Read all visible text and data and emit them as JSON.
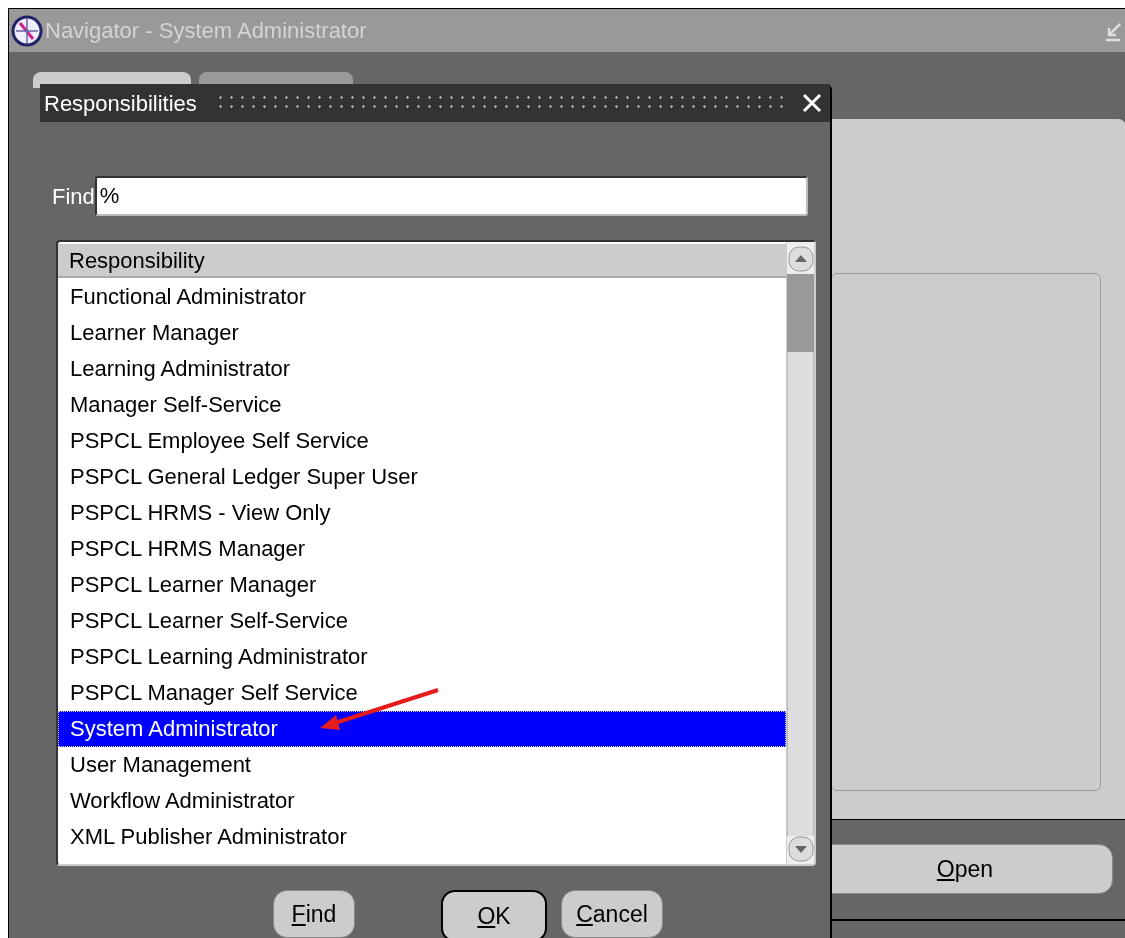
{
  "window": {
    "title": "Navigator - System Administrator"
  },
  "background": {
    "button": "Open"
  },
  "dialog": {
    "title": "Responsibilities",
    "find": {
      "label": "Find",
      "value": "%"
    },
    "list": {
      "header": "Responsibility",
      "rows": [
        {
          "label": "Functional Administrator",
          "selected": false
        },
        {
          "label": "Learner Manager",
          "selected": false
        },
        {
          "label": "Learning Administrator",
          "selected": false
        },
        {
          "label": "Manager Self-Service",
          "selected": false
        },
        {
          "label": "PSPCL Employee Self Service",
          "selected": false
        },
        {
          "label": "PSPCL General Ledger Super User",
          "selected": false
        },
        {
          "label": "PSPCL HRMS - View Only",
          "selected": false
        },
        {
          "label": "PSPCL HRMS Manager",
          "selected": false
        },
        {
          "label": "PSPCL Learner Manager",
          "selected": false
        },
        {
          "label": "PSPCL Learner Self-Service",
          "selected": false
        },
        {
          "label": "PSPCL Learning Administrator",
          "selected": false
        },
        {
          "label": "PSPCL Manager Self Service",
          "selected": false
        },
        {
          "label": "System Administrator",
          "selected": true
        },
        {
          "label": "User Management",
          "selected": false
        },
        {
          "label": "Workflow Administrator",
          "selected": false
        },
        {
          "label": "XML Publisher Administrator",
          "selected": false
        }
      ]
    },
    "buttons": [
      {
        "label": "Find",
        "kind": "plain"
      },
      {
        "label": "OK",
        "kind": "default"
      },
      {
        "label": "Cancel",
        "kind": "plain"
      }
    ]
  }
}
